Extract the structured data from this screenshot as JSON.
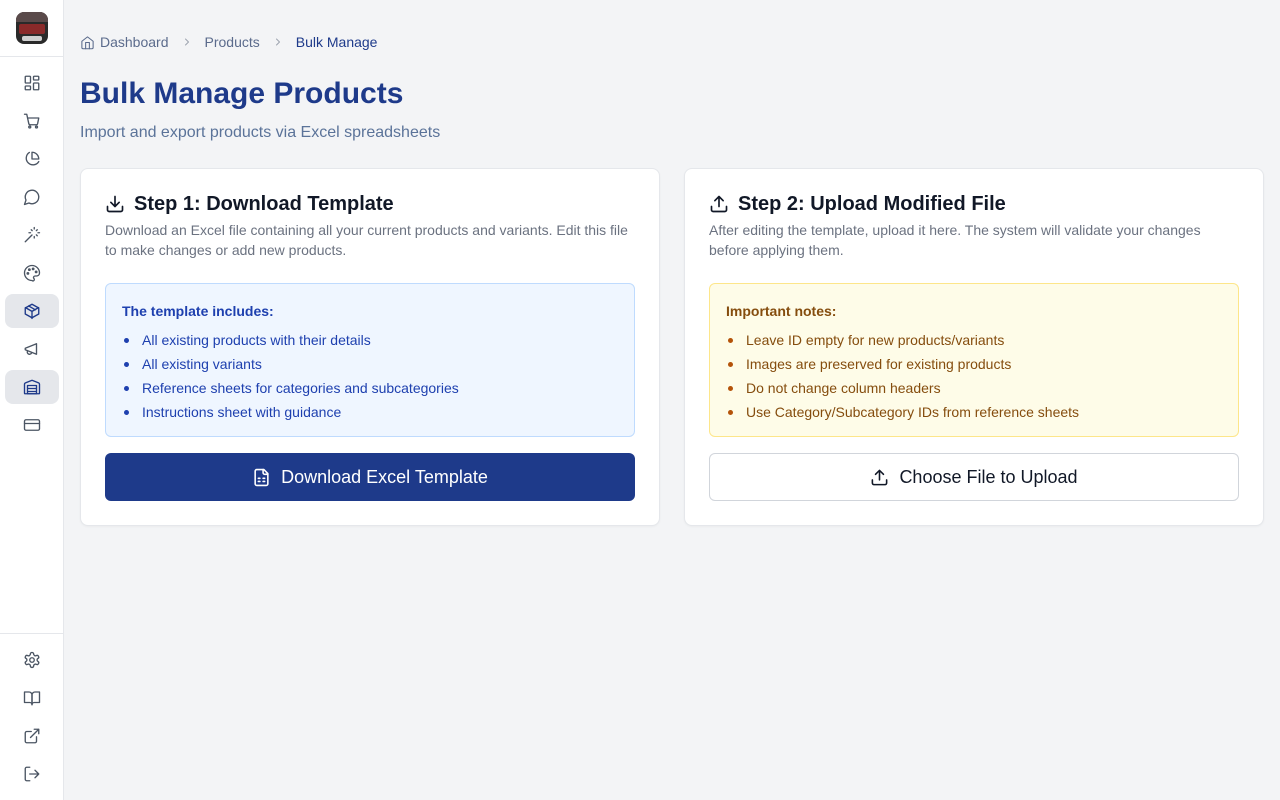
{
  "breadcrumb": {
    "items": [
      {
        "label": "Dashboard",
        "icon": "home-icon"
      },
      {
        "label": "Products"
      },
      {
        "label": "Bulk Manage"
      }
    ]
  },
  "page": {
    "title": "Bulk Manage Products",
    "subtitle": "Import and export products via Excel spreadsheets"
  },
  "sidebar": {
    "active_items": [
      "products",
      "warehouse"
    ],
    "top_icons": [
      "dashboard-icon",
      "cart-icon",
      "pie-chart-icon",
      "chat-icon",
      "magic-wand-icon",
      "palette-icon",
      "package-icon",
      "megaphone-icon",
      "warehouse-icon",
      "credit-card-icon"
    ],
    "bottom_icons": [
      "settings-icon",
      "book-icon",
      "external-link-icon",
      "logout-icon"
    ]
  },
  "step1": {
    "title": "Step 1: Download Template",
    "description": "Download an Excel file containing all your current products and variants. Edit this file to make changes or add new products.",
    "info_heading": "The template includes:",
    "info_items": [
      "All existing products with their details",
      "All existing variants",
      "Reference sheets for categories and subcategories",
      "Instructions sheet with guidance"
    ],
    "button_label": "Download Excel Template"
  },
  "step2": {
    "title": "Step 2: Upload Modified File",
    "description": "After editing the template, upload it here. The system will validate your changes before applying them.",
    "notes_heading": "Important notes:",
    "notes_items": [
      "Leave ID empty for new products/variants",
      "Images are preserved for existing products",
      "Do not change column headers",
      "Use Category/Subcategory IDs from reference sheets"
    ],
    "button_label": "Choose File to Upload"
  },
  "colors": {
    "primary": "#1e3a8a",
    "info_blue_bg": "#eff6ff",
    "notes_amber_bg": "#fefce8"
  }
}
